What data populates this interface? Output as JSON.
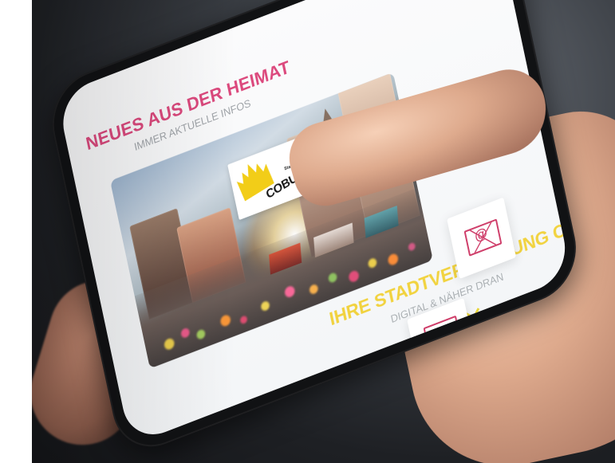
{
  "screen": {
    "headline": "NEUES AUS DER HEIMAT",
    "subline": "IMMER AKTUELLE INFOS"
  },
  "logo": {
    "stadt": "Stadt",
    "city": "COBURG"
  },
  "service": {
    "title": "IHRE STADTVERWALTUNG COBURG",
    "subtitle": "DIGITAL & NÄHER DRAN"
  },
  "icons": {
    "mail": "mail-at-icon",
    "calendar": "calendar-target-icon",
    "chevron": "chevron-down-icon"
  },
  "colors": {
    "headline": "#d72d69",
    "service_title": "#f1ce26",
    "logo": "#f2cd18",
    "icon_accent": "#cf3e6a"
  }
}
